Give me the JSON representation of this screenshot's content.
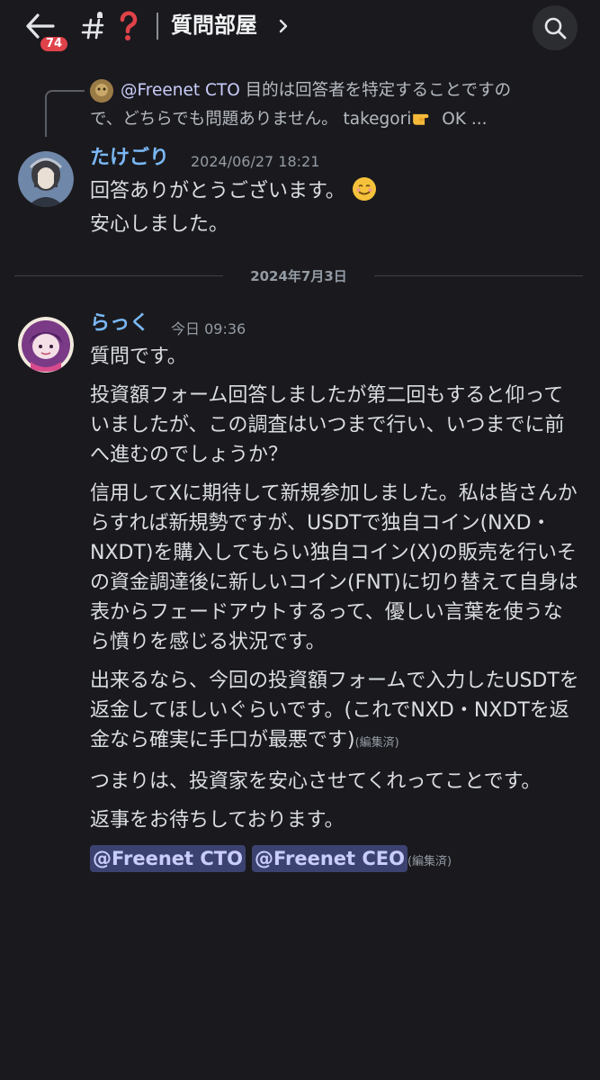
{
  "header": {
    "badge_count": "74",
    "channel_title": "質問部屋"
  },
  "reply": {
    "mention": "@Freenet CTO",
    "text_line1": " 目的は回答者を特定することですの",
    "text_line2a": "で、どちらでも問題ありません。 takegori",
    "text_line2b": " OK ..."
  },
  "messages": [
    {
      "author": "たけごり",
      "timestamp": "2024/06/27 18:21",
      "lines": [
        "回答ありがとうございます。",
        "安心しました。"
      ]
    },
    {
      "author": "らっく",
      "timestamp": "今日 09:36",
      "paragraphs": [
        "質問です。",
        "投資額フォーム回答しましたが第二回もすると仰っていましたが、この調査はいつまで行い、いつまでに前へ進むのでしょうか？",
        "信用してXに期待して新規参加しました。私は皆さんからすれば新規勢ですが、USDTで独自コイン(NXD・NXDT)を購入してもらい独自コイン(X)の販売を行いその資金調達後に新しいコイン(FNT)に切り替えて自身は表からフェードアウトするって、優しい言葉を使うなら憤りを感じる状況です。",
        "出来るなら、今回の投資額フォームで入力したUSDTを返金してほしいぐらいです。(これでNXD・NXDTを返金なら確実に手口が最悪です)",
        "つまりは、投資家を安心させてくれってことです。",
        "返事をお待ちしております。"
      ],
      "edited_label": "(編集済)",
      "mentions": [
        "@Freenet CTO",
        "@Freenet CEO"
      ],
      "final_edited_label": "(編集済)"
    }
  ],
  "date_separator": "2024年7月3日",
  "colors": {
    "background": "#1a1a1e",
    "author_blue": "#7ab8f5",
    "mention_bg": "#3c4270",
    "badge_red": "#e0424a"
  }
}
